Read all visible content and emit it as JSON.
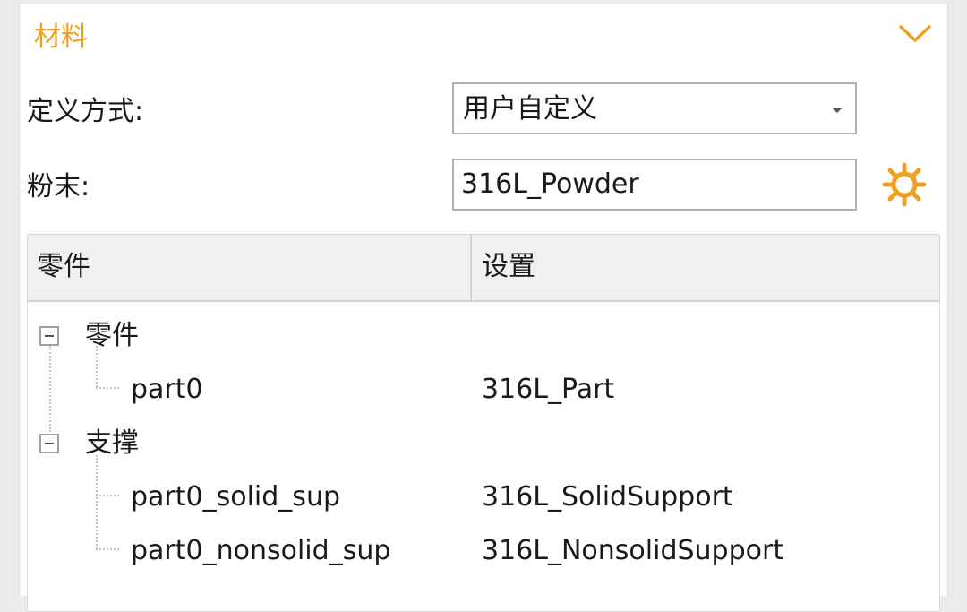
{
  "section": {
    "title": "材料",
    "accent_color": "#f0a020",
    "collapse_icon": "chevron-down-icon"
  },
  "definition": {
    "label": "定义方式:",
    "selected": "用户自定义"
  },
  "powder": {
    "label": "粉末:",
    "value": "316L_Powder",
    "settings_icon": "gear-icon"
  },
  "table": {
    "columns": [
      "零件",
      "设置"
    ],
    "groups": [
      {
        "label": "零件",
        "expanded": true,
        "children": [
          {
            "name": "part0",
            "setting": "316L_Part"
          }
        ]
      },
      {
        "label": "支撑",
        "expanded": true,
        "children": [
          {
            "name": "part0_solid_sup",
            "setting": "316L_SolidSupport"
          },
          {
            "name": "part0_nonsolid_sup",
            "setting": "316L_NonsolidSupport"
          }
        ]
      }
    ]
  }
}
